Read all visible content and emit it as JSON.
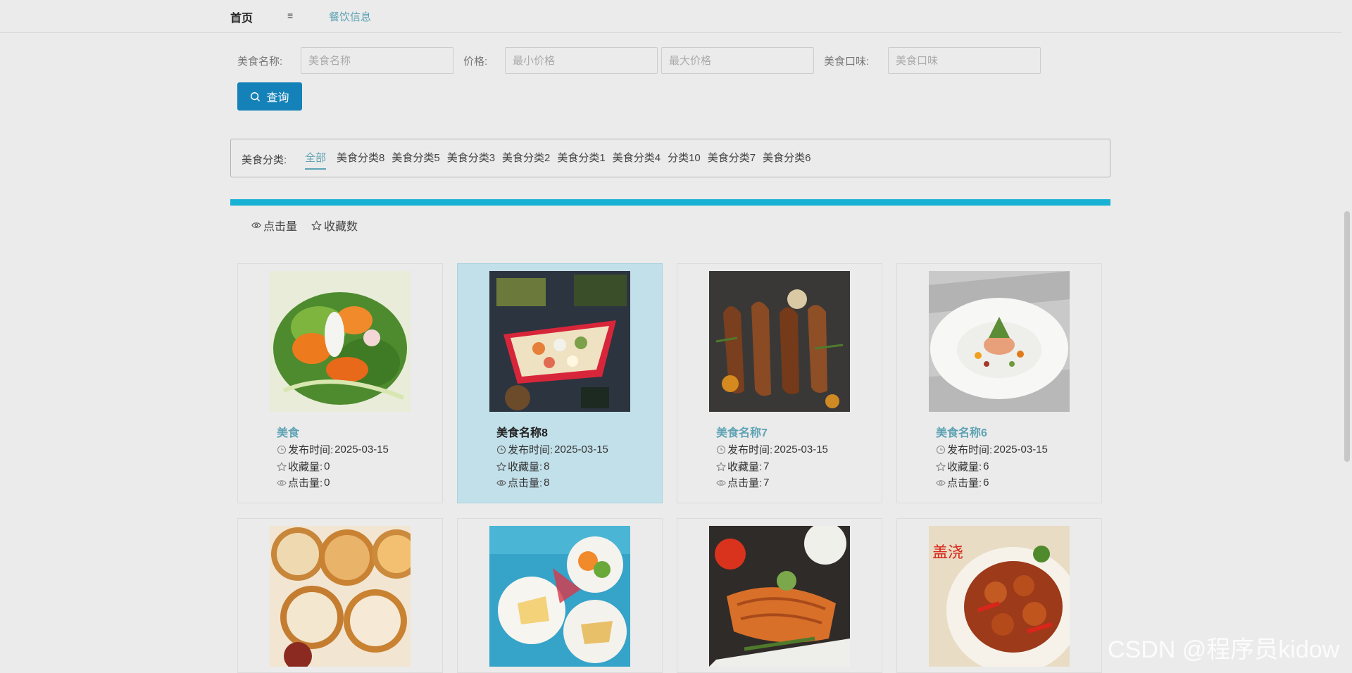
{
  "nav": {
    "home": "首页",
    "menu_icon": "≡",
    "food": "餐饮信息"
  },
  "search": {
    "name_label": "美食名称:",
    "name_placeholder": "美食名称",
    "price_label": "价格:",
    "min_price_placeholder": "最小价格",
    "max_price_placeholder": "最大价格",
    "taste_label": "美食口味:",
    "taste_placeholder": "美食口味",
    "query_button": "查询"
  },
  "categories": {
    "label": "美食分类:",
    "items": [
      "全部",
      "美食分类8",
      "美食分类5",
      "美食分类3",
      "美食分类2",
      "美食分类1",
      "美食分类4",
      "分类10",
      "美食分类7",
      "美食分类6"
    ]
  },
  "sorts": {
    "clicks": "点击量",
    "favorites": "收藏数"
  },
  "meta_labels": {
    "publish": "发布时间:",
    "favorites": "收藏量:",
    "clicks": "点击量:"
  },
  "cards": [
    {
      "name": "美食",
      "date": "2025-03-15",
      "favorites": "0",
      "clicks": "0"
    },
    {
      "name": "美食名称8",
      "date": "2025-03-15",
      "favorites": "8",
      "clicks": "8"
    },
    {
      "name": "美食名称7",
      "date": "2025-03-15",
      "favorites": "7",
      "clicks": "7"
    },
    {
      "name": "美食名称6",
      "date": "2025-03-15",
      "favorites": "6",
      "clicks": "6"
    }
  ],
  "watermark": "CSDN @程序员kidow",
  "colors": {
    "accent": "#5fa3b4",
    "button": "#1482b8",
    "divider": "#17b1d4",
    "hover_card": "#c2e0ea"
  }
}
